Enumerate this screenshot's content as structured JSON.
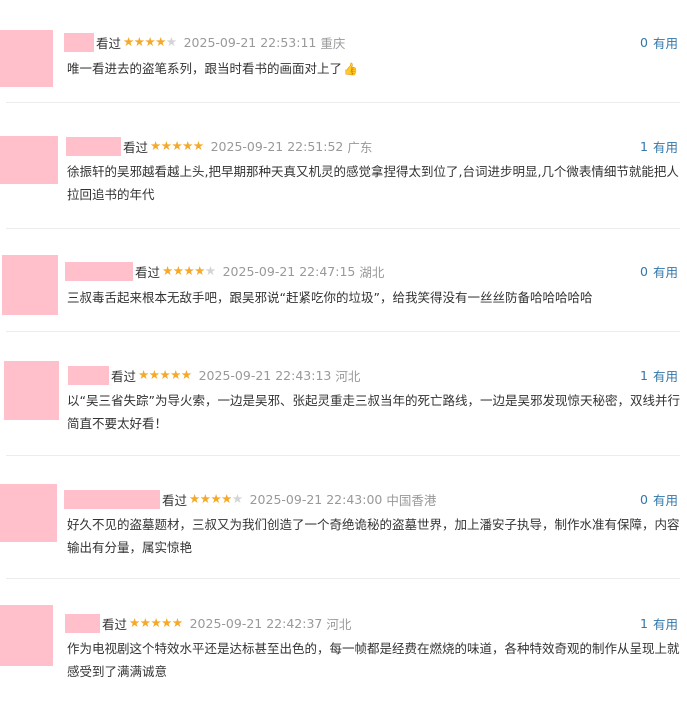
{
  "reviews": [
    {
      "status": "看过",
      "rating": 4,
      "time": "2025-09-21 22:53:11",
      "location": "重庆",
      "useful_count": "0",
      "useful_label": "有用",
      "text": "唯一看进去的盗笔系列，跟当时看书的画面对上了",
      "emoji": "👍"
    },
    {
      "status": "看过",
      "rating": 5,
      "time": "2025-09-21 22:51:52",
      "location": "广东",
      "useful_count": "1",
      "useful_label": "有用",
      "text": "徐振轩的吴邪越看越上头,把早期那种天真又机灵的感觉拿捏得太到位了,台词进步明显,几个微表情细节就能把人拉回追书的年代"
    },
    {
      "status": "看过",
      "rating": 4,
      "time": "2025-09-21 22:47:15",
      "location": "湖北",
      "useful_count": "0",
      "useful_label": "有用",
      "text": "三叔毒舌起来根本无敌手吧，跟吴邪说“赶紧吃你的垃圾”，给我笑得没有一丝丝防备哈哈哈哈哈"
    },
    {
      "status": "看过",
      "rating": 5,
      "time": "2025-09-21 22:43:13",
      "location": "河北",
      "useful_count": "1",
      "useful_label": "有用",
      "text": "以“吴三省失踪”为导火索，一边是吴邪、张起灵重走三叔当年的死亡路线，一边是吴邪发现惊天秘密，双线并行简直不要太好看！"
    },
    {
      "status": "看过",
      "rating": 4,
      "time": "2025-09-21 22:43:00",
      "location": "中国香港",
      "useful_count": "0",
      "useful_label": "有用",
      "text": "好久不见的盗墓题材，三叔又为我们创造了一个奇绝诡秘的盗墓世界，加上潘安子执导，制作水准有保障，内容输出有分量，属实惊艳"
    },
    {
      "status": "看过",
      "rating": 5,
      "time": "2025-09-21 22:42:37",
      "location": "河北",
      "useful_count": "1",
      "useful_label": "有用",
      "text": "作为电视剧这个特效水平还是达标甚至出色的，每一帧都是经费在燃烧的味道，各种特效奇观的制作从呈现上就感受到了满满诚意"
    }
  ],
  "colors": {
    "accent": "#3377aa",
    "star": "#f4a92a",
    "star_off": "#d4d4d4",
    "meta_gray": "#999999",
    "redaction": "#ffc0cb"
  }
}
